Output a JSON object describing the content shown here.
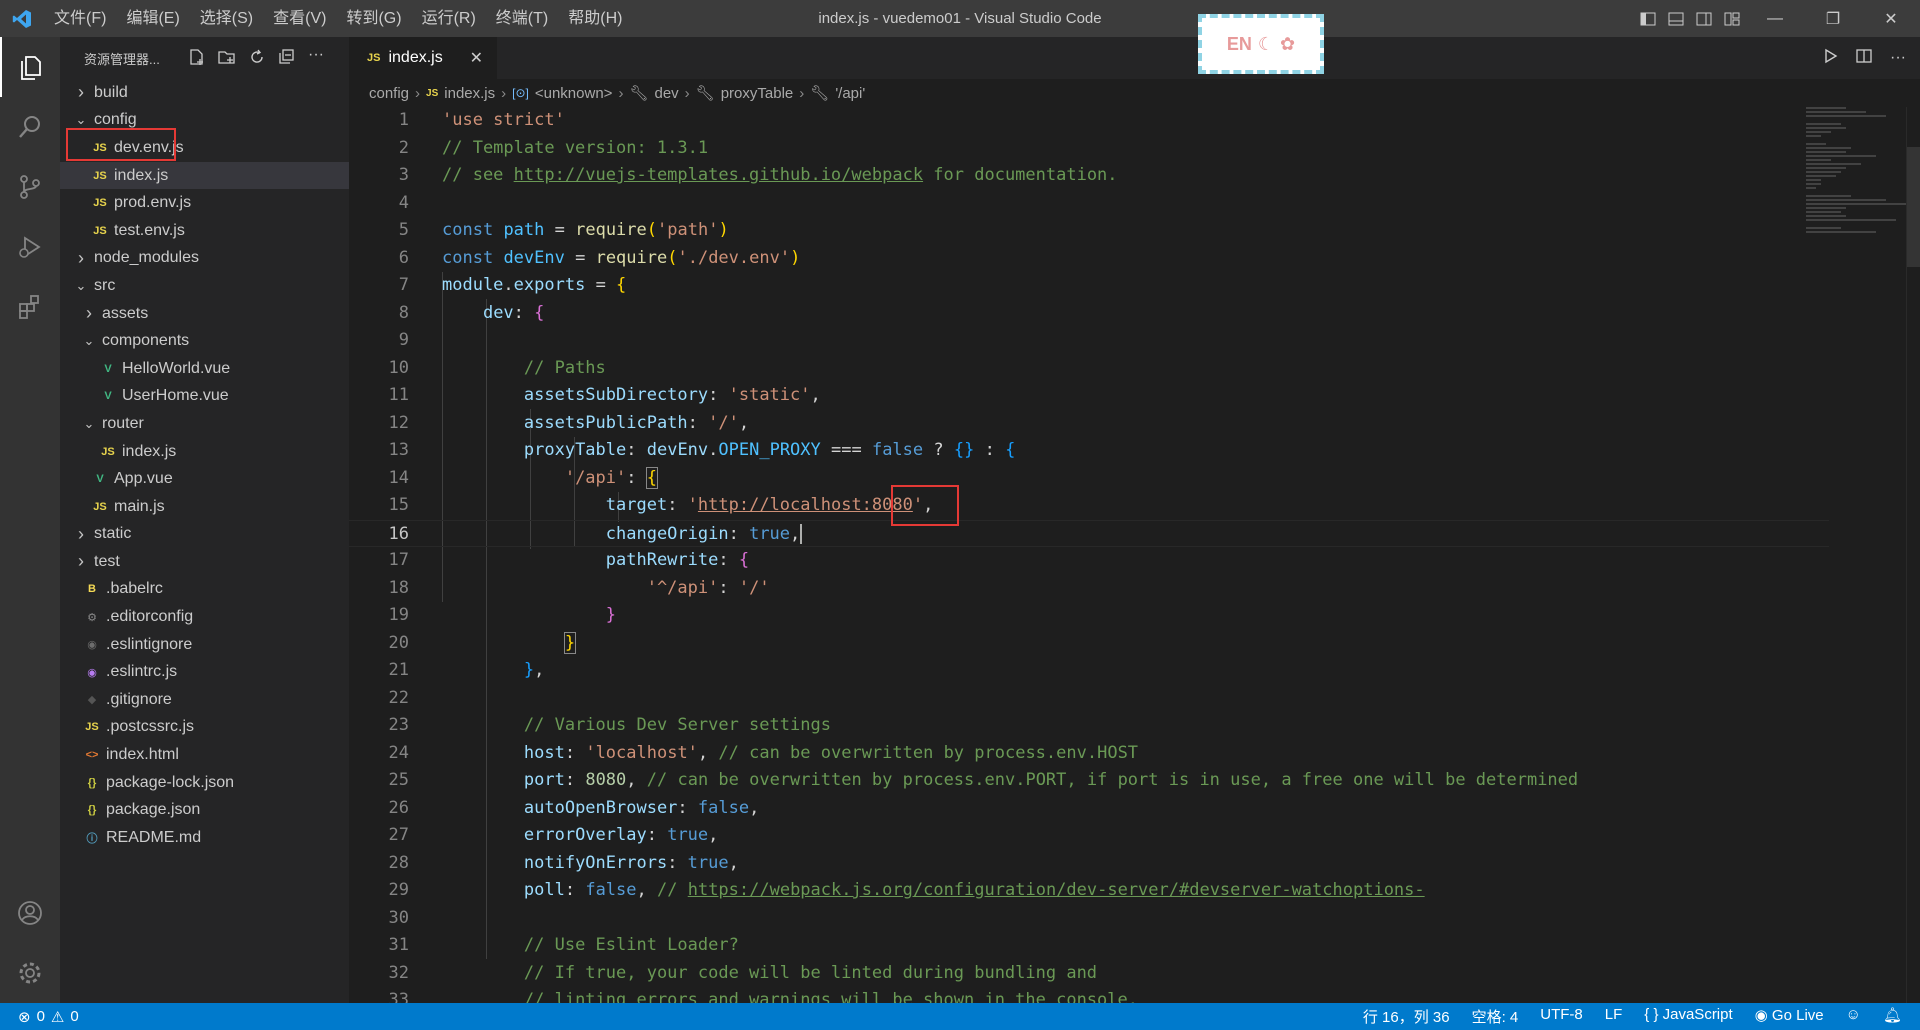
{
  "window": {
    "title": "index.js - vuedemo01 - Visual Studio Code",
    "menus": [
      "文件(F)",
      "编辑(E)",
      "选择(S)",
      "查看(V)",
      "转到(G)",
      "运行(R)",
      "终端(T)",
      "帮助(H)"
    ],
    "ime_label": "EN",
    "window_buttons": [
      "—",
      "❐",
      "✕"
    ]
  },
  "sidebar": {
    "title": "资源管理器...",
    "rows": [
      {
        "label": "build",
        "kind": "folder",
        "open": false,
        "indent": 0
      },
      {
        "label": "config",
        "kind": "folder",
        "open": true,
        "indent": 0
      },
      {
        "label": "dev.env.js",
        "kind": "js",
        "indent": 1
      },
      {
        "label": "index.js",
        "kind": "js",
        "indent": 1,
        "selected": true
      },
      {
        "label": "prod.env.js",
        "kind": "js",
        "indent": 1
      },
      {
        "label": "test.env.js",
        "kind": "js",
        "indent": 1
      },
      {
        "label": "node_modules",
        "kind": "folder",
        "open": false,
        "indent": 0
      },
      {
        "label": "src",
        "kind": "folder",
        "open": true,
        "indent": 0
      },
      {
        "label": "assets",
        "kind": "folder",
        "open": false,
        "indent": 1
      },
      {
        "label": "components",
        "kind": "folder",
        "open": true,
        "indent": 1
      },
      {
        "label": "HelloWorld.vue",
        "kind": "vue",
        "indent": 2
      },
      {
        "label": "UserHome.vue",
        "kind": "vue",
        "indent": 2
      },
      {
        "label": "router",
        "kind": "folder",
        "open": true,
        "indent": 1
      },
      {
        "label": "index.js",
        "kind": "js",
        "indent": 2
      },
      {
        "label": "App.vue",
        "kind": "vue",
        "indent": 1
      },
      {
        "label": "main.js",
        "kind": "js",
        "indent": 1
      },
      {
        "label": "static",
        "kind": "folder",
        "open": false,
        "indent": 0
      },
      {
        "label": "test",
        "kind": "folder",
        "open": false,
        "indent": 0
      },
      {
        "label": ".babelrc",
        "kind": "babel",
        "indent": 0
      },
      {
        "label": ".editorconfig",
        "kind": "gear",
        "indent": 0
      },
      {
        "label": ".eslintignore",
        "kind": "eslint-gray",
        "indent": 0
      },
      {
        "label": ".eslintrc.js",
        "kind": "eslint",
        "indent": 0
      },
      {
        "label": ".gitignore",
        "kind": "git",
        "indent": 0
      },
      {
        "label": ".postcssrc.js",
        "kind": "js",
        "indent": 0
      },
      {
        "label": "index.html",
        "kind": "html",
        "indent": 0
      },
      {
        "label": "package-lock.json",
        "kind": "json",
        "indent": 0
      },
      {
        "label": "package.json",
        "kind": "json",
        "indent": 0
      },
      {
        "label": "README.md",
        "kind": "info",
        "indent": 0
      }
    ]
  },
  "tab": {
    "label": "index.js",
    "icon": "JS"
  },
  "breadcrumb": [
    "config",
    "index.js",
    "<unknown>",
    "dev",
    "proxyTable",
    "'/api'"
  ],
  "editor": {
    "current_line": 16,
    "line_numbers": [
      "1",
      "2",
      "3",
      "4",
      "5",
      "6",
      "7",
      "8",
      "9",
      "10",
      "11",
      "12",
      "13",
      "14",
      "15",
      "16",
      "17",
      "18",
      "19",
      "20",
      "21",
      "22",
      "23",
      "24",
      "25",
      "26",
      "27",
      "28",
      "29",
      "30",
      "31",
      "32",
      "33"
    ]
  },
  "statusbar": {
    "errors": "0",
    "warnings": "0",
    "position": "行 16，列 36",
    "spaces": "空格: 4",
    "encoding": "UTF-8",
    "eol": "LF",
    "language": "JavaScript",
    "golive": "Go Live"
  }
}
